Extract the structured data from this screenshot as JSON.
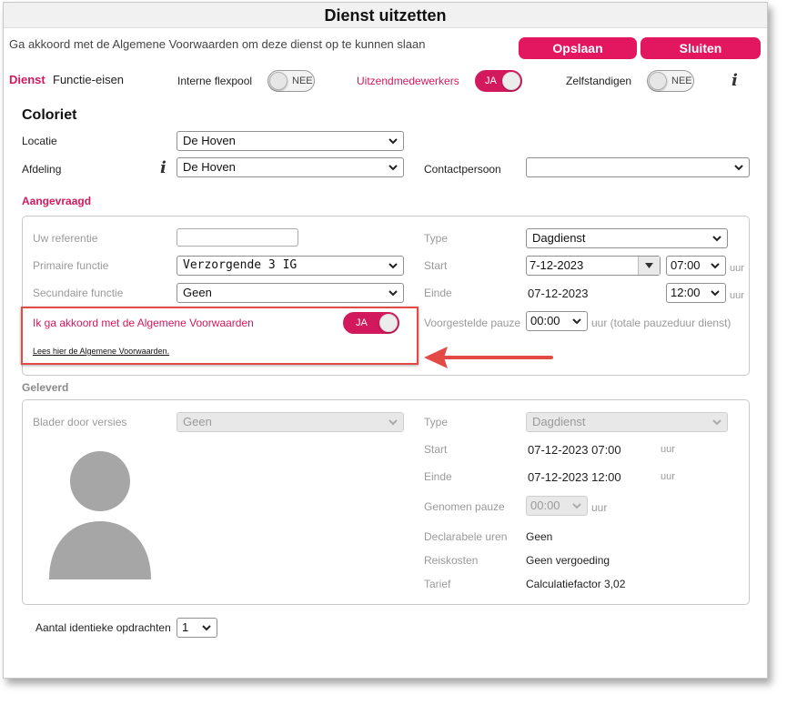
{
  "dialog": {
    "title": "Dienst uitzetten",
    "notice": "Ga akkoord met de Algemene Voorwaarden om deze dienst op te kunnen slaan",
    "save_label": "Opslaan",
    "close_label": "Sluiten"
  },
  "tabs": [
    {
      "label": "Dienst",
      "active": true
    },
    {
      "label": "Functie-eisen",
      "active": false
    }
  ],
  "toggles": {
    "interne_flexpool": {
      "label": "Interne flexpool",
      "value": "NEE"
    },
    "uitzendmedewerkers": {
      "label": "Uitzendmedewerkers",
      "value": "JA"
    },
    "zelfstandigen": {
      "label": "Zelfstandigen",
      "value": "NEE"
    }
  },
  "client": {
    "name": "Coloriet",
    "locatie_label": "Locatie",
    "locatie_value": "De Hoven",
    "afdeling_label": "Afdeling",
    "afdeling_value": "De Hoven",
    "contact_label": "Contactpersoon",
    "contact_value": ""
  },
  "aangevraagd": {
    "title": "Aangevraagd",
    "referentie_label": "Uw referentie",
    "referentie_value": "",
    "primaire_label": "Primaire functie",
    "primaire_value": "Verzorgende 3 IG",
    "secundaire_label": "Secundaire functie",
    "secundaire_value": "Geen",
    "type_label": "Type",
    "type_value": "Dagdienst",
    "start_label": "Start",
    "start_date": "7-12-2023",
    "start_time": "07:00",
    "einde_label": "Einde",
    "einde_date": "07-12-2023",
    "einde_time": "12:00",
    "uur": "uur",
    "pauze_label": "Voorgestelde pauze",
    "pauze_value": "00:00",
    "pauze_suffix": "uur (totale pauzeduur dienst)",
    "akkoord_label": "Ik ga akkoord met de Algemene Voorwaarden",
    "akkoord_value": "JA",
    "voorwaarden_link": "Lees hier de Algemene Voorwaarden."
  },
  "geleverd": {
    "title": "Geleverd",
    "versies_label": "Blader door versies",
    "versies_value": "Geen",
    "type_label": "Type",
    "type_value": "Dagdienst",
    "start_label": "Start",
    "start_value": "07-12-2023 07:00",
    "einde_label": "Einde",
    "einde_value": "07-12-2023 12:00",
    "uur": "uur",
    "pauze_label": "Genomen pauze",
    "pauze_value": "00:00",
    "declarabel_label": "Declarabele uren",
    "declarabel_value": "Geen",
    "reiskosten_label": "Reiskosten",
    "reiskosten_value": "Geen vergoeding",
    "tarief_label": "Tarief",
    "tarief_value": "Calculatiefactor 3,02"
  },
  "footer": {
    "aantal_label": "Aantal identieke opdrachten",
    "aantal_value": "1"
  },
  "colors": {
    "accent": "#e3175f",
    "annotation": "#e34a45"
  }
}
